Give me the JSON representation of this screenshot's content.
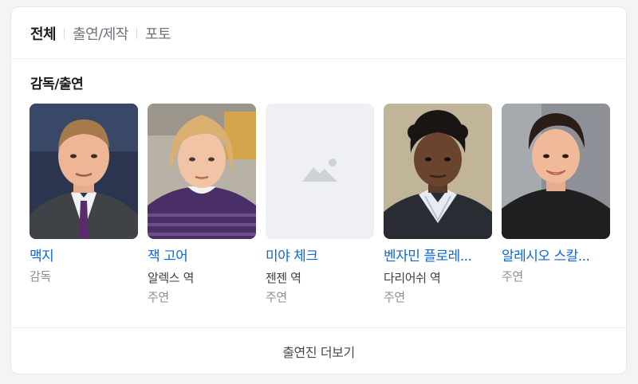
{
  "tabs": [
    {
      "label": "전체",
      "active": true
    },
    {
      "label": "출연/제작",
      "active": false
    },
    {
      "label": "포토",
      "active": false
    }
  ],
  "section": {
    "title": "감독/출연"
  },
  "people": [
    {
      "name": "맥지",
      "role": "감독",
      "type": "",
      "photo": "portrait-photo"
    },
    {
      "name": "잭 고어",
      "role": "알렉스 역",
      "type": "주연",
      "photo": "portrait-photo"
    },
    {
      "name": "미야 체크",
      "role": "젠젠 역",
      "type": "주연",
      "photo": "image-placeholder-icon"
    },
    {
      "name": "벤자민 플로레...",
      "role": "다리어쉬 역",
      "type": "주연",
      "photo": "portrait-photo"
    },
    {
      "name": "알레시오 스칼...",
      "role": "주연",
      "type": "",
      "photo": "portrait-photo"
    }
  ],
  "more": {
    "label": "출연진 더보기"
  },
  "colors": {
    "link": "#0b67d8",
    "text": "#1b1c1e",
    "muted": "#8a8e95"
  }
}
